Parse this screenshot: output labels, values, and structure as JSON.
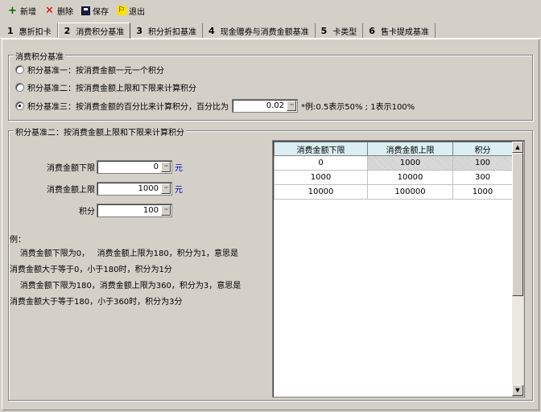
{
  "toolbar": {
    "add": "新增",
    "delete": "删除",
    "save": "保存",
    "exit": "退出"
  },
  "tabs": [
    {
      "num": "1",
      "label": "惠折扣卡"
    },
    {
      "num": "2",
      "label": "消费积分基准"
    },
    {
      "num": "3",
      "label": "积分折扣基准"
    },
    {
      "num": "4",
      "label": "现金赠券与消费金额基准"
    },
    {
      "num": "5",
      "label": "卡类型"
    },
    {
      "num": "6",
      "label": "售卡提成基准"
    }
  ],
  "basis_group": {
    "title": "消费积分基准",
    "option1": "积分基准一：按消费金额一元一个积分",
    "option2": "积分基准二：按消费金额上限和下限来计算积分",
    "option3": "积分基准三：按消费金额的百分比来计算积分，百分比为",
    "percent_value": "0.02",
    "percent_hint": "*例:0.5表示50%  ;  1表示100%"
  },
  "range_group": {
    "title": "积分基准二：按消费金额上限和下限来计算积分",
    "lower_label": "消费金额下限",
    "lower_value": "0",
    "upper_label": "消费金额上限",
    "upper_value": "1000",
    "points_label": "积分",
    "points_value": "100",
    "unit": "元",
    "example_title": "例：",
    "example_line1": "    消费金额下限为0，   消费金额上限为180，积分为1，意思是",
    "example_line2": "消费金额大于等于0，小于180时，积分为1分",
    "example_line3": "    消费金额下限为180，消费金额上限为360，积分为3，意思是",
    "example_line4": "消费金额大于等于180，小于360时，积分为3分"
  },
  "grid": {
    "headers": [
      "消费金额下限",
      "消费金额上限",
      "积分"
    ],
    "rows": [
      [
        "0",
        "1000",
        "100"
      ],
      [
        "1000",
        "10000",
        "300"
      ],
      [
        "10000",
        "100000",
        "1000"
      ]
    ]
  }
}
